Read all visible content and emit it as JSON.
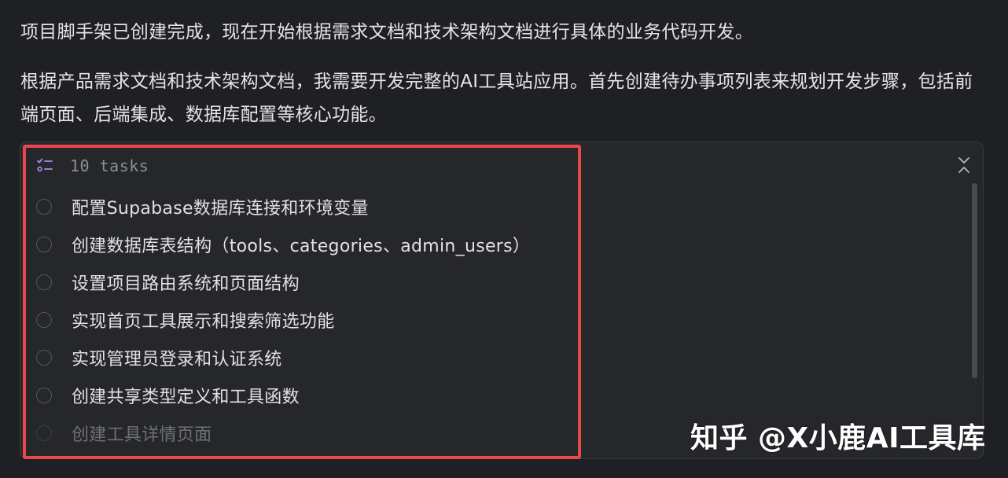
{
  "message": {
    "paragraph1": "项目脚手架已创建完成，现在开始根据需求文档和技术架构文档进行具体的业务代码开发。",
    "paragraph2": "根据产品需求文档和技术架构文档，我需要开发完整的AI工具站应用。首先创建待办事项列表来规划开发步骤，包括前端页面、后端集成、数据库配置等核心功能。"
  },
  "task_panel": {
    "header_icon": "checklist-icon",
    "count_label": "10 tasks",
    "collapse_icon": "collapse-icon",
    "tasks": [
      {
        "label": "配置Supabase数据库连接和环境变量",
        "done": false
      },
      {
        "label": "创建数据库表结构（tools、categories、admin_users）",
        "done": false
      },
      {
        "label": "设置项目路由系统和页面结构",
        "done": false
      },
      {
        "label": "实现首页工具展示和搜索筛选功能",
        "done": false
      },
      {
        "label": "实现管理员登录和认证系统",
        "done": false
      },
      {
        "label": "创建共享类型定义和工具函数",
        "done": false
      },
      {
        "label": "创建工具详情页面",
        "done": false
      }
    ]
  },
  "colors": {
    "background": "#1f2023",
    "panel": "#26272b",
    "highlight": "#e8474b",
    "accent_icon": "#a98cf0"
  },
  "watermark": "知乎 @X小鹿AI工具库"
}
